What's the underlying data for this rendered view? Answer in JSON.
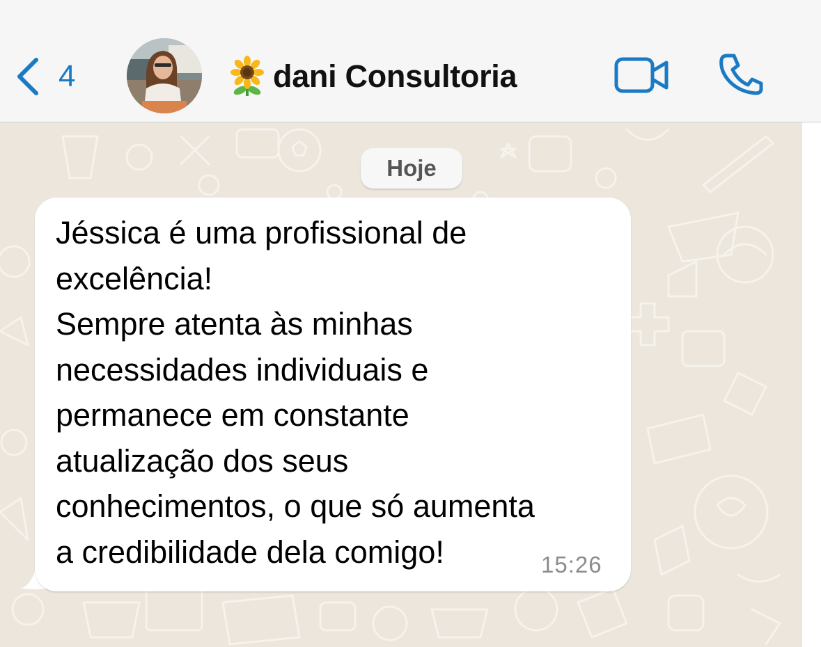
{
  "header": {
    "back_count": "4",
    "contact_name": "dani Consultoria",
    "accent_color": "#1a7ac4"
  },
  "icons": {
    "back": "chevron-left-icon",
    "video": "video-camera-icon",
    "call": "phone-icon",
    "name_emoji": "sunflower-icon"
  },
  "chat": {
    "date_label": "Hoje",
    "messages": [
      {
        "direction": "incoming",
        "text": "Jéssica é uma profissional de\nexcelência!\nSempre atenta às minhas\nnecessidades individuais e\npermanece em constante\natualização dos seus\nconhecimentos, o que só aumenta\na credibilidade dela comigo!",
        "time": "15:26"
      }
    ]
  },
  "colors": {
    "header_bg": "#f6f6f6",
    "chat_bg": "#ece6dd",
    "bubble_bg": "#ffffff",
    "time_color": "#8c8c8c"
  }
}
